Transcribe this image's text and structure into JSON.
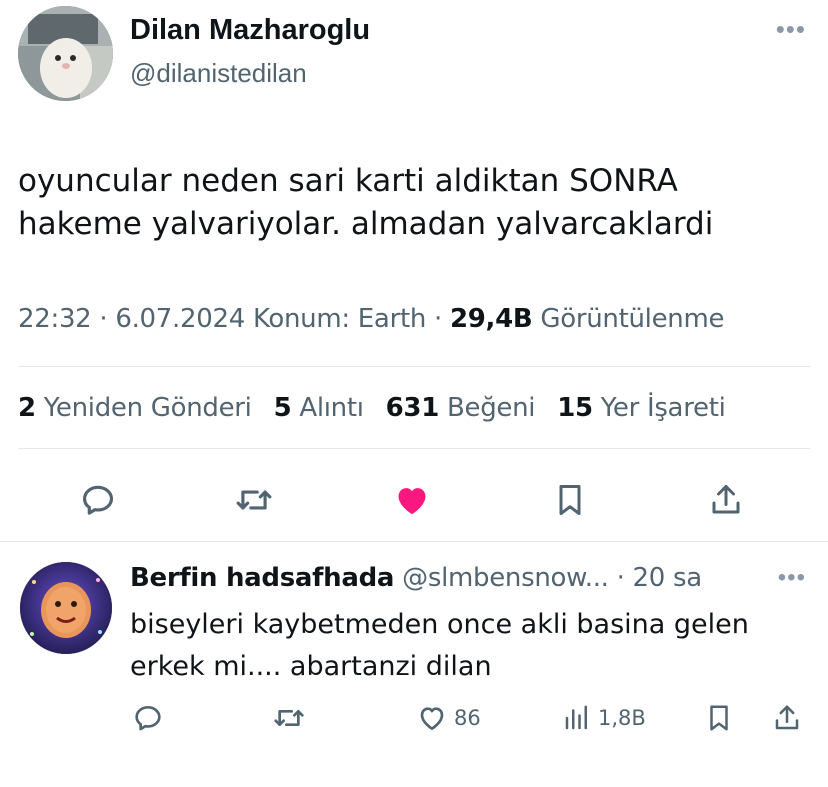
{
  "tweet": {
    "display_name": "Dilan Mazharoglu",
    "handle": "@dilanistedilan",
    "text_line1": "oyuncular neden sari karti aldiktan SONRA",
    "text_line2": "hakeme yalvariyolar. almadan yalvarcaklardi",
    "time": "22:32",
    "date": "6.07.2024",
    "location": "Konum: Earth",
    "views_count": "29,4B",
    "views_label": "Görüntülenme",
    "stats": {
      "retweets_count": "2",
      "retweets_label": "Yeniden Gönderi",
      "quotes_count": "5",
      "quotes_label": "Alıntı",
      "likes_count": "631",
      "likes_label": "Beğeni",
      "bookmarks_count": "15",
      "bookmarks_label": "Yer İşareti"
    },
    "liked": true
  },
  "reply": {
    "display_name": "Berfin hadsafhada",
    "handle": "@slmbensnow...",
    "time": "20 sa",
    "text_line1": "biseyleri kaybetmeden once akli basina gelen",
    "text_line2": "erkek mi.... abartanzi dilan",
    "likes": "86",
    "views": "1,8B"
  },
  "icons": [
    "more-icon",
    "reply-icon",
    "retweet-icon",
    "heart-icon",
    "bookmark-icon",
    "share-icon",
    "views-icon"
  ],
  "colors": {
    "like": "#f91880",
    "secondary_text": "#536471",
    "primary_text": "#0f1419",
    "divider": "#e4e8eb"
  }
}
